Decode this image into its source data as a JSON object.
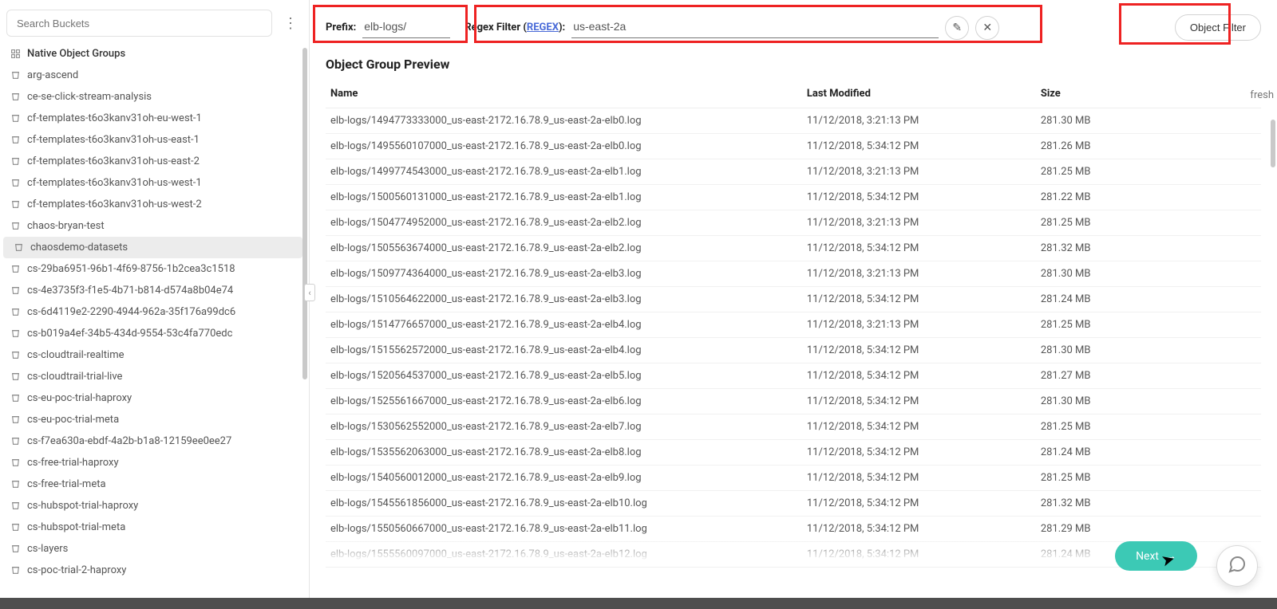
{
  "sidebar": {
    "search_placeholder": "Search Buckets",
    "native_groups_label": "Native Object Groups",
    "active_bucket": "chaosdemo-datasets",
    "buckets": [
      "arg-ascend",
      "ce-se-click-stream-analysis",
      "cf-templates-t6o3kanv31oh-eu-west-1",
      "cf-templates-t6o3kanv31oh-us-east-1",
      "cf-templates-t6o3kanv31oh-us-east-2",
      "cf-templates-t6o3kanv31oh-us-west-1",
      "cf-templates-t6o3kanv31oh-us-west-2",
      "chaos-bryan-test",
      "chaosdemo-datasets",
      "cs-29ba6951-96b1-4f69-8756-1b2cea3c1518",
      "cs-4e3735f3-f1e5-4b71-b814-d574a8b04e74",
      "cs-6d4119e2-2290-4944-962a-35f176a99dc6",
      "cs-b019a4ef-34b5-434d-9554-53c4fa770edc",
      "cs-cloudtrail-realtime",
      "cs-cloudtrail-trial-live",
      "cs-eu-poc-trial-haproxy",
      "cs-eu-poc-trial-meta",
      "cs-f7ea630a-ebdf-4a2b-b1a8-12159ee0ee27",
      "cs-free-trial-haproxy",
      "cs-free-trial-meta",
      "cs-hubspot-trial-haproxy",
      "cs-hubspot-trial-meta",
      "cs-layers",
      "cs-poc-trial-2-haproxy"
    ]
  },
  "filter": {
    "prefix_label": "Prefix:",
    "prefix_value": "elb-logs/",
    "regex_label_pre": "Regex Filter (",
    "regex_link": "REGEX",
    "regex_label_post": "):",
    "regex_value": "us-east-2a",
    "object_filter_label": "Object Filter"
  },
  "preview": {
    "title": "Object Group Preview",
    "refresh_stub": "fresh",
    "columns": {
      "name": "Name",
      "modified": "Last Modified",
      "size": "Size"
    },
    "rows": [
      {
        "name": "elb-logs/1494773333000_us-east-2172.16.78.9_us-east-2a-elb0.log",
        "modified": "11/12/2018, 3:21:13 PM",
        "size": "281.30 MB"
      },
      {
        "name": "elb-logs/1495560107000_us-east-2172.16.78.9_us-east-2a-elb0.log",
        "modified": "11/12/2018, 5:34:12 PM",
        "size": "281.26 MB"
      },
      {
        "name": "elb-logs/1499774543000_us-east-2172.16.78.9_us-east-2a-elb1.log",
        "modified": "11/12/2018, 3:21:13 PM",
        "size": "281.25 MB"
      },
      {
        "name": "elb-logs/1500560131000_us-east-2172.16.78.9_us-east-2a-elb1.log",
        "modified": "11/12/2018, 5:34:12 PM",
        "size": "281.22 MB"
      },
      {
        "name": "elb-logs/1504774952000_us-east-2172.16.78.9_us-east-2a-elb2.log",
        "modified": "11/12/2018, 3:21:13 PM",
        "size": "281.25 MB"
      },
      {
        "name": "elb-logs/1505563674000_us-east-2172.16.78.9_us-east-2a-elb2.log",
        "modified": "11/12/2018, 5:34:12 PM",
        "size": "281.32 MB"
      },
      {
        "name": "elb-logs/1509774364000_us-east-2172.16.78.9_us-east-2a-elb3.log",
        "modified": "11/12/2018, 3:21:13 PM",
        "size": "281.30 MB"
      },
      {
        "name": "elb-logs/1510564622000_us-east-2172.16.78.9_us-east-2a-elb3.log",
        "modified": "11/12/2018, 5:34:12 PM",
        "size": "281.24 MB"
      },
      {
        "name": "elb-logs/1514776657000_us-east-2172.16.78.9_us-east-2a-elb4.log",
        "modified": "11/12/2018, 3:21:13 PM",
        "size": "281.25 MB"
      },
      {
        "name": "elb-logs/1515562572000_us-east-2172.16.78.9_us-east-2a-elb4.log",
        "modified": "11/12/2018, 5:34:12 PM",
        "size": "281.30 MB"
      },
      {
        "name": "elb-logs/1520564537000_us-east-2172.16.78.9_us-east-2a-elb5.log",
        "modified": "11/12/2018, 5:34:12 PM",
        "size": "281.27 MB"
      },
      {
        "name": "elb-logs/1525561667000_us-east-2172.16.78.9_us-east-2a-elb6.log",
        "modified": "11/12/2018, 5:34:12 PM",
        "size": "281.30 MB"
      },
      {
        "name": "elb-logs/1530562552000_us-east-2172.16.78.9_us-east-2a-elb7.log",
        "modified": "11/12/2018, 5:34:12 PM",
        "size": "281.25 MB"
      },
      {
        "name": "elb-logs/1535562063000_us-east-2172.16.78.9_us-east-2a-elb8.log",
        "modified": "11/12/2018, 5:34:12 PM",
        "size": "281.24 MB"
      },
      {
        "name": "elb-logs/1540560012000_us-east-2172.16.78.9_us-east-2a-elb9.log",
        "modified": "11/12/2018, 5:34:12 PM",
        "size": "281.25 MB"
      },
      {
        "name": "elb-logs/1545561856000_us-east-2172.16.78.9_us-east-2a-elb10.log",
        "modified": "11/12/2018, 5:34:12 PM",
        "size": "281.32 MB"
      },
      {
        "name": "elb-logs/1550560667000_us-east-2172.16.78.9_us-east-2a-elb11.log",
        "modified": "11/12/2018, 5:34:12 PM",
        "size": "281.29 MB"
      },
      {
        "name": "elb-logs/1555560097000_us-east-2172.16.78.9_us-east-2a-elb12.log",
        "modified": "11/12/2018, 5:34:12 PM",
        "size": "281.24 MB"
      }
    ]
  },
  "footer": {
    "next_label": "Next"
  }
}
